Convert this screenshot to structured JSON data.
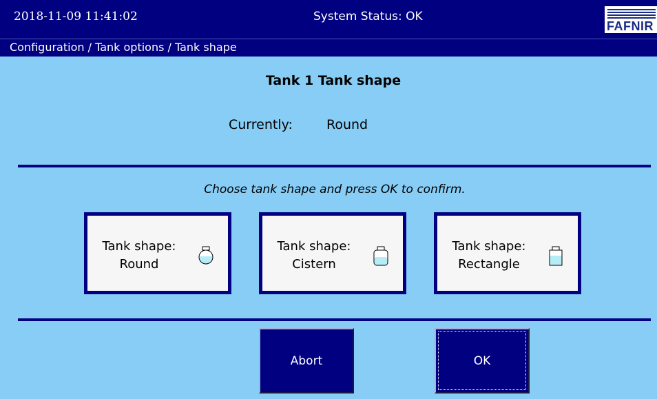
{
  "header": {
    "datetime": "2018-11-09  11:41:02",
    "status": "System Status: OK",
    "logo_text": "FAFNIR"
  },
  "breadcrumb": "Configuration / Tank options / Tank shape",
  "page": {
    "title": "Tank 1 Tank shape",
    "current_label": "Currently:",
    "current_value": "Round",
    "instruction": "Choose tank shape and press OK to confirm."
  },
  "shapes": [
    {
      "line1": "Tank shape:",
      "line2": "Round",
      "icon": "round-tank-icon"
    },
    {
      "line1": "Tank shape:",
      "line2": "Cistern",
      "icon": "cistern-tank-icon"
    },
    {
      "line1": "Tank shape:",
      "line2": "Rectangle",
      "icon": "rectangle-tank-icon"
    }
  ],
  "actions": {
    "abort": "Abort",
    "ok": "OK"
  },
  "colors": {
    "background": "#87cdf6",
    "bar": "#000080",
    "button_face": "#f6f6f6",
    "liquid": "#b6ecf6"
  }
}
